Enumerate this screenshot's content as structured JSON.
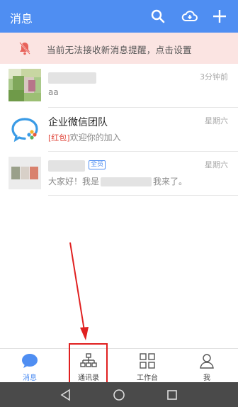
{
  "header": {
    "title": "消息",
    "icons": [
      "search-icon",
      "cloud-icon",
      "plus-icon"
    ],
    "color": "#4f8ef2"
  },
  "alert": {
    "text": "当前无法接收新消息提醒，点击设置",
    "icon": "bell-mute-icon",
    "bg": "#fbe4e2"
  },
  "chats": [
    {
      "name": "",
      "preview": "aa",
      "time": "3分钟前"
    },
    {
      "name": "企业微信团队",
      "tag": "[红包]",
      "preview": "欢迎你的加入",
      "time": "星期六"
    },
    {
      "name": "",
      "badge": "全员",
      "preview_prefix": "大家好！我是",
      "preview_suffix": "我来了。",
      "time": "星期六"
    }
  ],
  "tabs": [
    {
      "label": "消息",
      "icon": "chat-bubble-icon",
      "active": true
    },
    {
      "label": "通讯录",
      "icon": "org-chart-icon",
      "active": false
    },
    {
      "label": "工作台",
      "icon": "grid-icon",
      "active": false
    },
    {
      "label": "我",
      "icon": "person-icon",
      "active": false
    }
  ],
  "system_nav": [
    "back-icon",
    "home-icon",
    "recents-icon"
  ]
}
